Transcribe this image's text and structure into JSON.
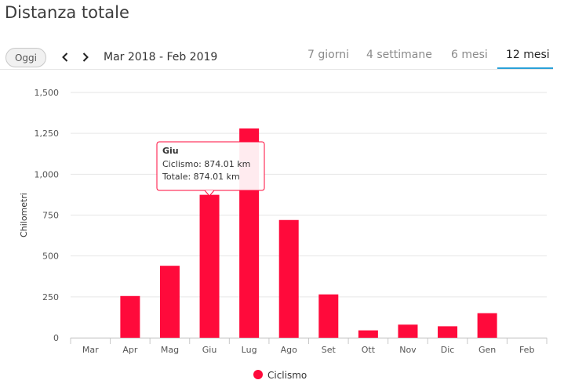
{
  "page": {
    "title": "Distanza totale"
  },
  "controls": {
    "today_label": "Oggi",
    "prev_icon": "chevron-left-icon",
    "next_icon": "chevron-right-icon",
    "date_range": "Mar 2018 - Feb 2019",
    "tabs": [
      {
        "label": "7 giorni",
        "active": false
      },
      {
        "label": "4 settimane",
        "active": false
      },
      {
        "label": "6 mesi",
        "active": false
      },
      {
        "label": "12 mesi",
        "active": true
      }
    ],
    "accent_color": "#2aa1d8"
  },
  "tooltip": {
    "title": "Giu",
    "line1": "Ciclismo: 874.01 km",
    "line2": "Totale: 874.01 km"
  },
  "chart_data": {
    "type": "bar",
    "categories": [
      "Mar",
      "Apr",
      "Mag",
      "Giu",
      "Lug",
      "Ago",
      "Set",
      "Ott",
      "Nov",
      "Dic",
      "Gen",
      "Feb"
    ],
    "series": [
      {
        "name": "Ciclismo",
        "color": "#ff0a3b",
        "values": [
          0,
          255,
          440,
          874.01,
          1280,
          720,
          265,
          45,
          80,
          70,
          150,
          0
        ]
      }
    ],
    "ylabel": "Chilometri",
    "ylim": [
      0,
      1500
    ],
    "yticks": [
      0,
      250,
      500,
      750,
      1000,
      1250,
      1500
    ],
    "ytick_labels": [
      "0",
      "250",
      "500",
      "750",
      "1,000",
      "1,250",
      "1,500"
    ],
    "grid": true,
    "legend": "bottom-center"
  }
}
